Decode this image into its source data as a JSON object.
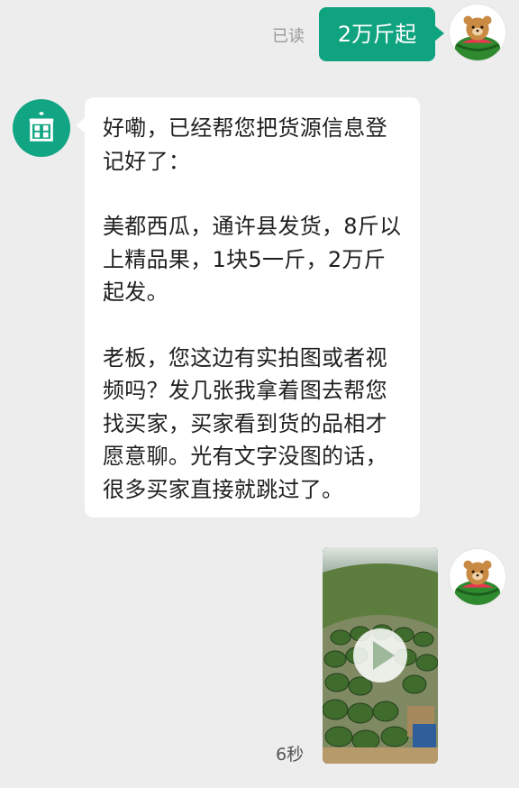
{
  "conversation": {
    "read_status": "已读",
    "outgoing_text": "2万斤起",
    "incoming_paragraphs": [
      "好嘞，已经帮您把货源信息登记好了：",
      "美都西瓜，通许县发货，8斤以上精品果，1块5一斤，2万斤起发。",
      "老板，您这边有实拍图或者视频吗？发几张我拿着图去帮您找买家，买家看到货的品相才愿意聊。光有文字没图的话，很多买家直接就跳过了。"
    ],
    "video_duration": "6秒"
  },
  "colors": {
    "outgoing_bubble": "#10a37f",
    "bot_avatar": "#12a583",
    "background": "#ededed"
  },
  "icons": {
    "bot_avatar": "storefront-icon",
    "user_avatar": "bear-watermelon-avatar",
    "video_play": "play-icon"
  }
}
